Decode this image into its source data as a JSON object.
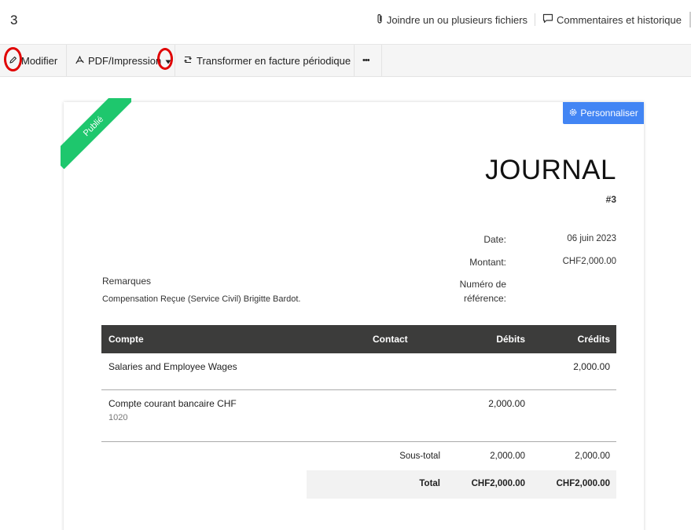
{
  "header": {
    "doc_number": "3",
    "attach_label": "Joindre un ou plusieurs fichiers",
    "comments_label": "Commentaires et historique"
  },
  "toolbar": {
    "edit_label": "Modifier",
    "pdf_label": "PDF/Impression",
    "recurring_label": "Transformer en facture périodique",
    "more_label": "•••"
  },
  "document": {
    "status_ribbon": "Publié",
    "customize_label": "Personnaliser",
    "title": "JOURNAL",
    "reference": "#3",
    "meta": [
      {
        "label": "Date:",
        "value": "06 juin 2023"
      },
      {
        "label": "Montant:",
        "value": "CHF2,000.00"
      },
      {
        "label": "Numéro de référence:",
        "value": ""
      }
    ],
    "remarks_title": "Remarques",
    "remarks_text": "Compensation Reçue (Service Civil) Brigitte Bardot.",
    "table": {
      "headers": [
        "Compte",
        "Contact",
        "Débits",
        "Crédits"
      ],
      "rows": [
        {
          "account": "Salaries and Employee Wages",
          "sub": "",
          "contact": "",
          "debit": "",
          "credit": "2,000.00"
        },
        {
          "account": "Compte courant bancaire CHF",
          "sub": "1020",
          "contact": "",
          "debit": "2,000.00",
          "credit": ""
        }
      ],
      "subtotal": {
        "label": "Sous-total",
        "debit": "2,000.00",
        "credit": "2,000.00"
      },
      "total": {
        "label": "Total",
        "debit": "CHF2,000.00",
        "credit": "CHF2,000.00"
      }
    }
  },
  "colors": {
    "ribbon": "#1ec76d",
    "customize_button": "#4285f4",
    "table_header": "#3c3c3b",
    "highlight": "#e00000"
  },
  "icons": [
    "paperclip-icon",
    "comment-icon",
    "pencil-icon",
    "pdf-icon",
    "caret-down-icon",
    "recurring-icon",
    "gear-icon"
  ]
}
